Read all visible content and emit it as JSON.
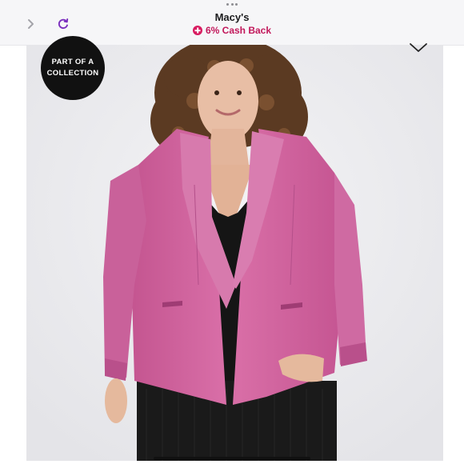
{
  "header": {
    "title": "Macy's",
    "cashback_label": "6% Cash Back",
    "back_icon": "chevron-left-icon",
    "refresh_icon": "refresh-icon",
    "more_icon": "more-dots-icon"
  },
  "product": {
    "badge_line1": "PART OF A",
    "badge_line2": "COLLECTION",
    "wishlist_icon": "heart-icon",
    "image_alt": "Pink open-front blazer over black dress"
  },
  "colors": {
    "accent": "#c2185b",
    "refresh": "#7b2fbe",
    "blazer": "#d0669f",
    "badge": "#111111"
  }
}
